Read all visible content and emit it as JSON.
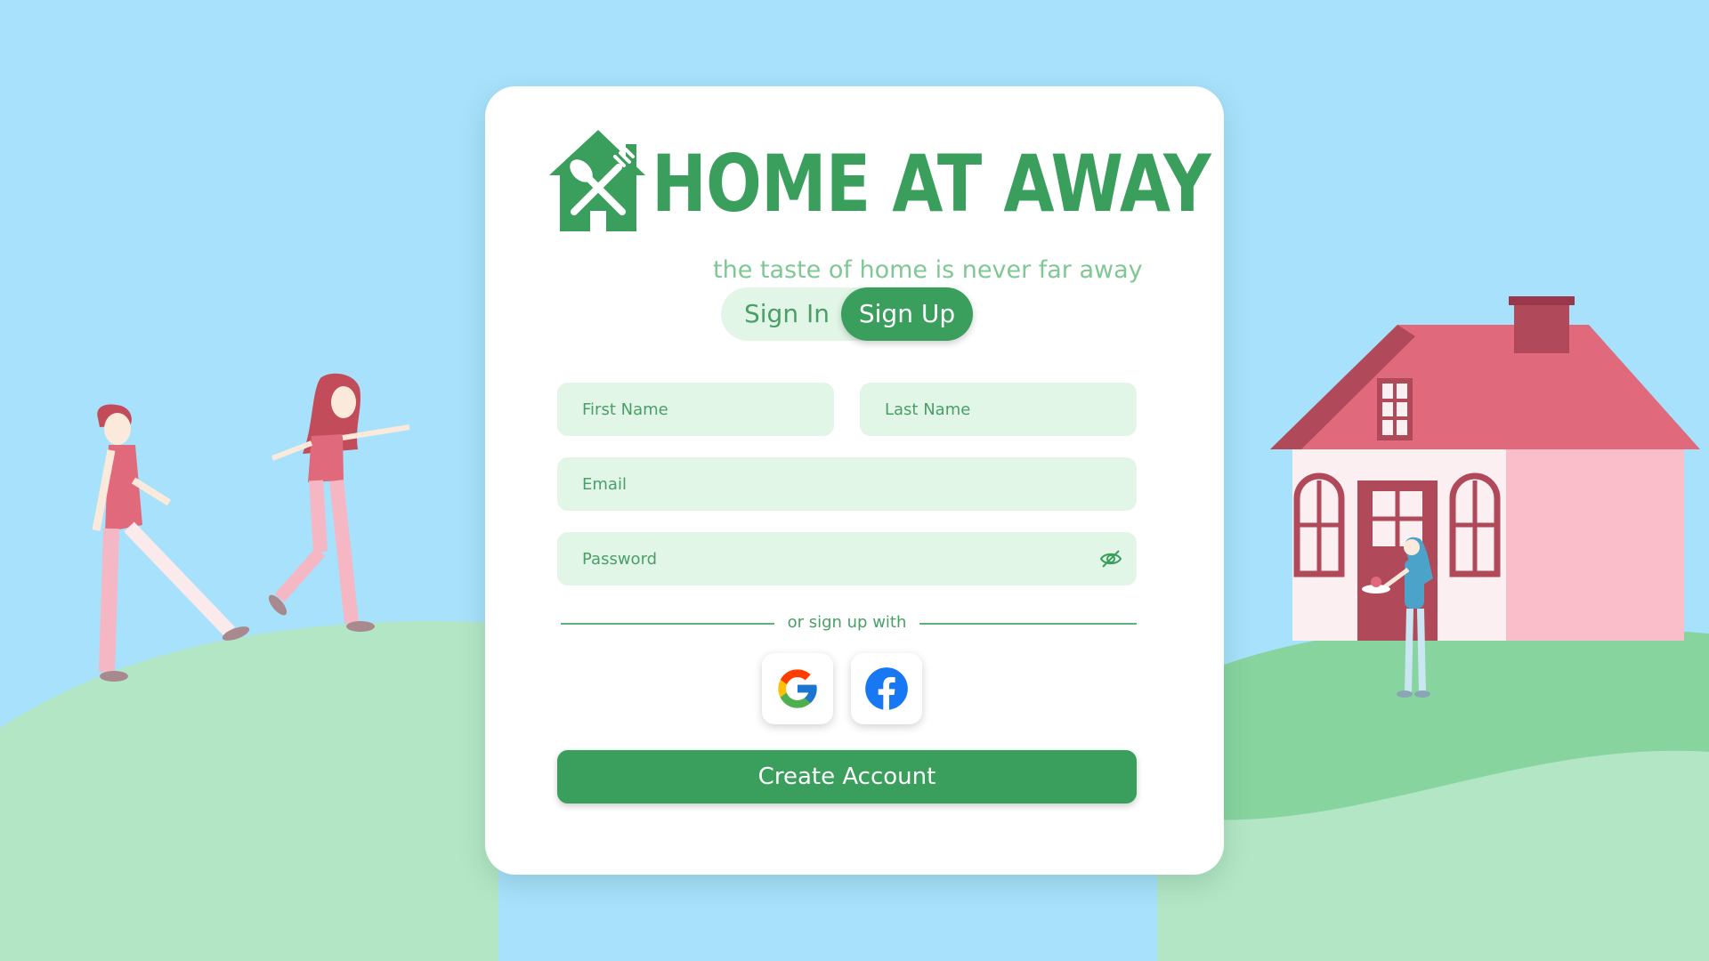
{
  "brand": {
    "title": "HOME AT AWAY",
    "tagline": "the taste of home is never far away",
    "logo_icon": "house-utensils-icon"
  },
  "auth_toggle": {
    "sign_in_label": "Sign In",
    "sign_up_label": "Sign Up",
    "active": "Sign Up"
  },
  "form": {
    "first_name": {
      "placeholder": "First Name",
      "value": ""
    },
    "last_name": {
      "placeholder": "Last Name",
      "value": ""
    },
    "email": {
      "placeholder": "Email",
      "value": ""
    },
    "password": {
      "placeholder": "Password",
      "value": "",
      "toggle_icon": "eye-slash-icon"
    }
  },
  "social": {
    "divider_label": "or sign up with",
    "providers": [
      {
        "name": "google",
        "icon": "google-icon"
      },
      {
        "name": "facebook",
        "icon": "facebook-icon"
      }
    ]
  },
  "submit_label": "Create Account",
  "colors": {
    "brand_green": "#3a9e5c",
    "field_bg": "#e2f6e7",
    "sky": "#a7e1fb",
    "hill": "#b3e6c4",
    "house_roof": "#e06a7c"
  }
}
